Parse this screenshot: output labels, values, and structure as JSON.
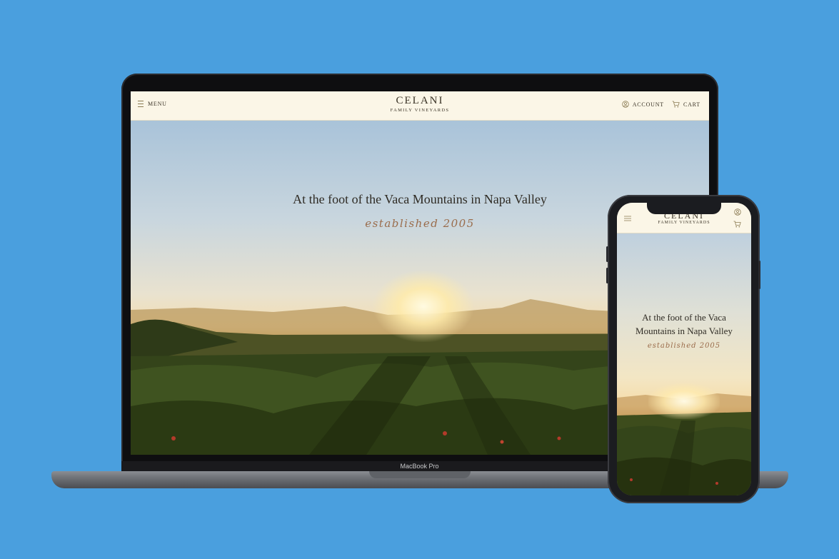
{
  "desktop": {
    "header": {
      "menu_label": "MENU",
      "logo_main": "CELANI",
      "logo_sub": "FAMILY VINEYARDS",
      "account_label": "ACCOUNT",
      "cart_label": "CART"
    },
    "hero": {
      "title": "At the foot of the Vaca Mountains in Napa Valley",
      "script": "established 2005"
    }
  },
  "mobile": {
    "header": {
      "logo_main": "CELANI",
      "logo_sub": "FAMILY VINEYARDS"
    },
    "hero": {
      "title_line1": "At the foot of the Vaca",
      "title_line2": "Mountains in Napa Valley",
      "script": "established 2005"
    }
  },
  "device": {
    "laptop_label": "MacBook Pro"
  },
  "icons": [
    "menu-icon",
    "account-icon",
    "cart-icon"
  ],
  "colors": {
    "background": "#4a9fde",
    "header_bg": "#fbf6e7",
    "text": "#3a3326",
    "script": "#9a6c4b"
  }
}
